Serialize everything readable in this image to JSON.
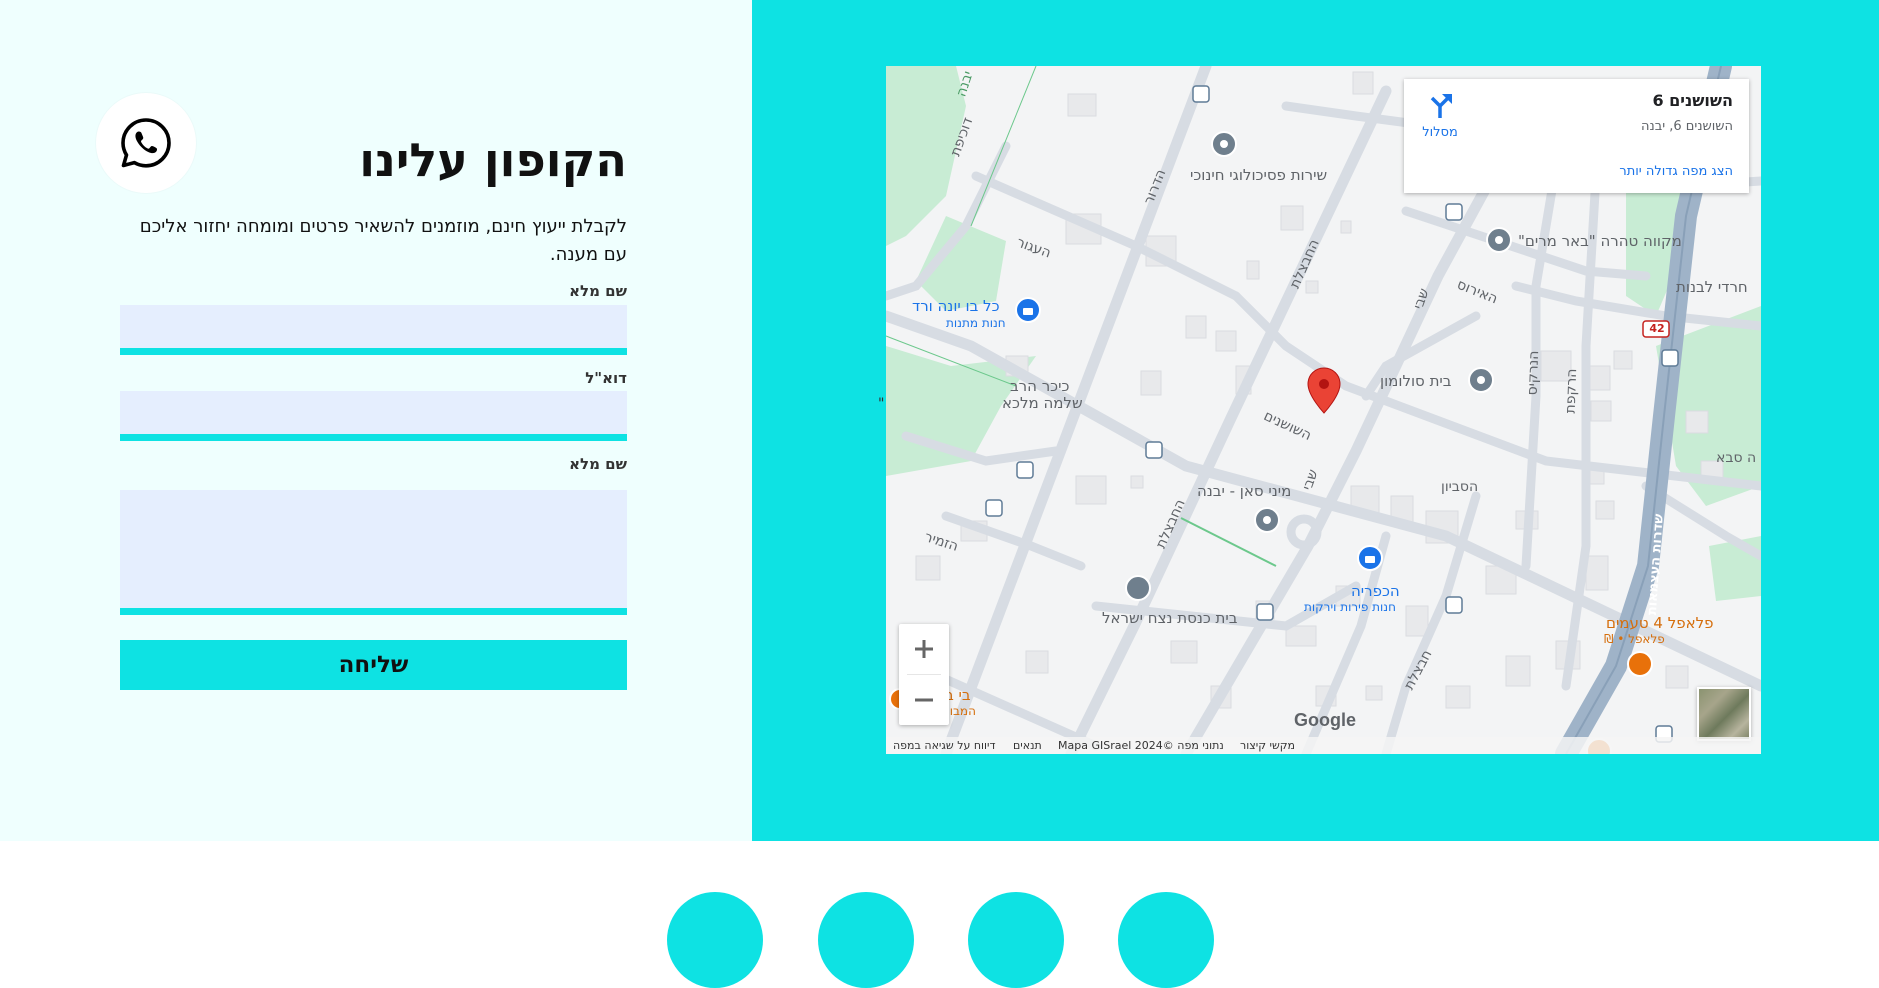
{
  "contact": {
    "title": "הקופון עלינו",
    "subtitle": "לקבלת ייעוץ חינם, מוזמנים להשאיר פרטים ומומחה יחזור אליכם עם מענה.",
    "fields": [
      {
        "label": "שם מלא",
        "value": "",
        "placeholder": ""
      },
      {
        "label": "דוא\"ל",
        "value": "",
        "placeholder": ""
      },
      {
        "label": "שם מלא",
        "value": "",
        "placeholder": ""
      }
    ],
    "submit_label": "שליחה"
  },
  "map": {
    "card": {
      "place_name": "השושנים 6",
      "address": "השושנים 6, יבנה",
      "directions_label": "מסלול",
      "bigger_map_link": "הצג מפה גדולה יותר"
    },
    "streets": {
      "hashoshanim": "השושנים",
      "havatzelet_top": "החבצלת",
      "havatzelet_bottom": "החבצלת",
      "hadar": "הדרור",
      "hagoor": "העגור",
      "hairis": "האירוס",
      "hanarkis": "הנרקיס",
      "hakefet": "הרקפת",
      "hasavyon": "הסביון",
      "shvi_top": "שבי",
      "shvi_mid": "שבי",
      "hazamir": "הזמיר",
      "havatzelet2": "חבצלת",
      "dukhifat": "דוכיפת",
      "yavne_edge": "יבנה",
      "atzmaut": "שדרות העצמאות",
      "route_shield": "42",
      "hasavev_edge": "ה סבא"
    },
    "pois": {
      "psych_service": "שירות פסיכולוגי חינוכי",
      "mikve": "מקווה טהרה \"באר מרים\"",
      "charedi_girls": "חרדי לבנות",
      "kol_bo_name": "כל בו יונה ורד",
      "kol_bo_type": "חנות מתנות",
      "kikar_line1": "כיכר הרב",
      "kikar_line2": "שלמה מלכא",
      "beit_solomon": "בית סולומון",
      "mini_san": "מיני סאן - יבנה",
      "hakfaria_name": "הכפריה",
      "hakfaria_type": "חנות פירות וירקות",
      "synagogue": "בית כנסת נצח ישראל",
      "falafel_name": "פלאפל 4 טעמים",
      "falafel_sub": "פלאפל • ₪",
      "bi_bo_line1": "בי בו",
      "bi_bo_line2": "המבורג"
    },
    "footer": {
      "shortcuts": "מקשי קיצור",
      "data": "נתוני מפה ©2024 Mapa GISrael",
      "terms": "תנאים",
      "report": "דיווח על שגיאה במפה"
    },
    "google_logo": "Google",
    "stray_mark": "\""
  },
  "icons": {
    "whatsapp": "whatsapp-icon",
    "directions": "directions-icon",
    "zoom_in": "plus-icon",
    "zoom_out": "minus-icon",
    "pin": "location-pin-icon"
  },
  "colors": {
    "accent": "#0ee2e3",
    "left_bg": "#effffe",
    "field_bg": "#e5eefe",
    "map_link": "#1a73e8",
    "pin": "#ea4335"
  }
}
